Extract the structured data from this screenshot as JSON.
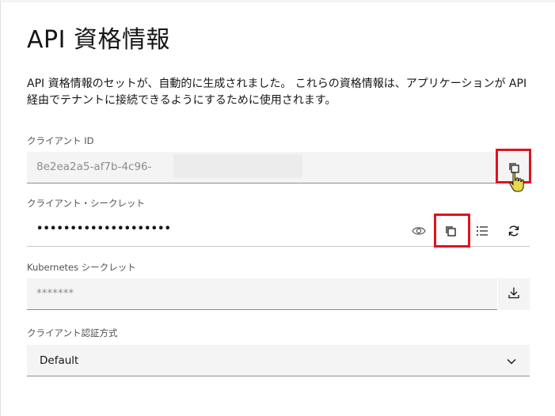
{
  "title": "API 資格情報",
  "description": "API 資格情報のセットが、自動的に生成されました。 これらの資格情報は、アプリケーションが API 経由でテナントに接続できるようにするために使用されます。",
  "client_id": {
    "label": "クライアント ID",
    "value": "8e2ea2a5-af7b-4c96-",
    "copy_icon": "copy-icon"
  },
  "client_secret": {
    "label": "クライアント・シークレット",
    "value": "••••••••••••••••••••",
    "icons": [
      "view-icon",
      "copy-icon",
      "list-icon",
      "refresh-icon"
    ]
  },
  "kubernetes_secret": {
    "label": "Kubernetes シークレット",
    "value": "*******",
    "download_icon": "download-icon"
  },
  "auth_method": {
    "label": "クライアント認証方式",
    "selected": "Default",
    "chevron_icon": "chevron-down-icon"
  },
  "colors": {
    "highlight": "#e0121f",
    "field_bg": "#f4f4f4",
    "cursor": "#e8d84a"
  }
}
